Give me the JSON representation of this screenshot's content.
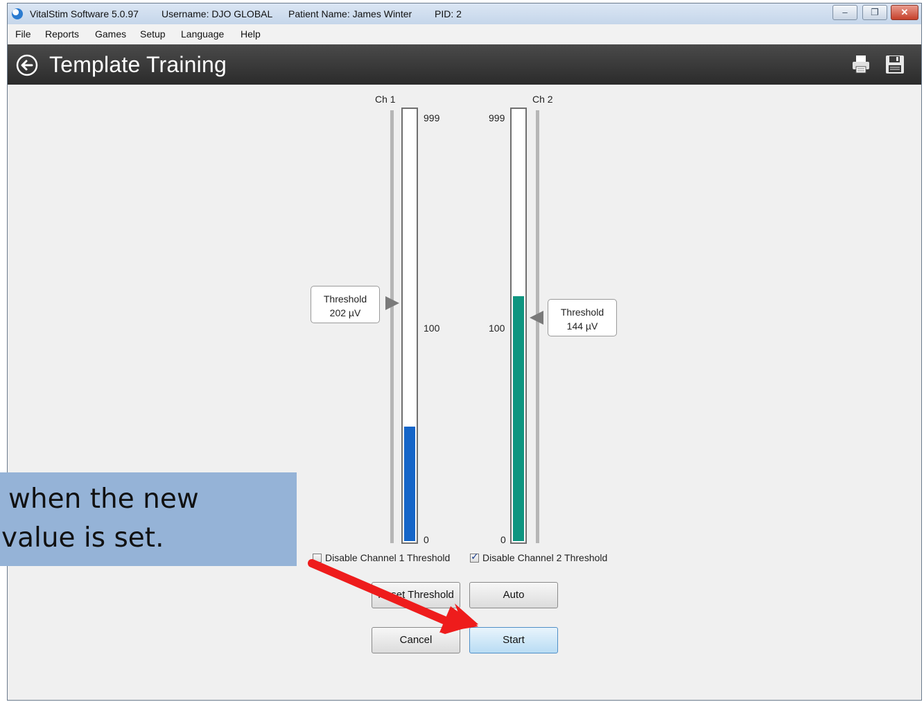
{
  "window": {
    "app_title": "VitalStim Software 5.0.97",
    "username": "Username: DJO GLOBAL",
    "patient": "Patient Name: James Winter",
    "pid": "PID: 2",
    "controls": {
      "minimize": "–",
      "restore": "❐",
      "close": "✕"
    }
  },
  "menu": {
    "items": [
      "File",
      "Reports",
      "Games",
      "Setup",
      "Language",
      "Help"
    ]
  },
  "header": {
    "title": "Template Training",
    "back_icon": "back-arrow-circle-icon",
    "print_icon": "printer-icon",
    "save_icon": "floppy-disk-icon"
  },
  "channels": [
    {
      "label": "Ch 1",
      "scale_max": "999",
      "scale_mid": "100",
      "scale_min": "0",
      "threshold_label": "Threshold",
      "threshold_value": "202 µV",
      "color": "#1565c8",
      "disable_label": "Disable Channel 1 Threshold",
      "disabled": false
    },
    {
      "label": "Ch 2",
      "scale_max": "999",
      "scale_mid": "100",
      "scale_min": "0",
      "threshold_label": "Threshold",
      "threshold_value": "144 µV",
      "color": "#0f9580",
      "disable_label": "Disable Channel 2 Threshold",
      "disabled": true
    }
  ],
  "buttons": {
    "reset_threshold": "Reset Threshold",
    "auto": "Auto",
    "cancel": "Cancel",
    "start": "Start"
  },
  "callout": {
    "line1": "when the new",
    "line2": "value is set."
  }
}
